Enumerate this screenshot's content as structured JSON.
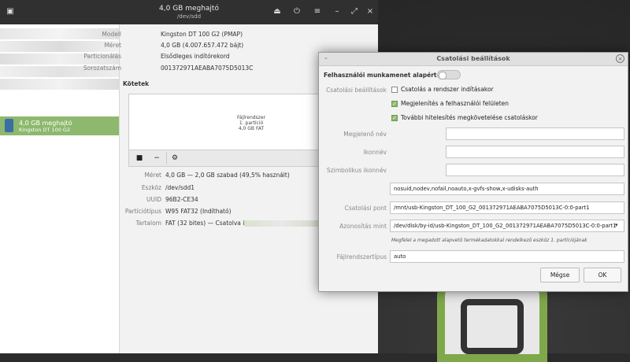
{
  "window": {
    "title": "4,0 GB meghajtó",
    "subtitle": "/dev/sdd",
    "icons": [
      "drives-icon",
      "eject-icon",
      "power-icon",
      "menu-icon",
      "minimize-icon",
      "maximize-icon",
      "close-icon"
    ]
  },
  "sidebar": {
    "selected_drive": {
      "name": "4,0 GB meghajtó",
      "model": "Kingston DT 100 G2"
    }
  },
  "drive_info": [
    {
      "label": "Modell",
      "value": "Kingston DT 100 G2 (PMAP)"
    },
    {
      "label": "Méret",
      "value": "4,0 GB (4.007.657.472 bájt)"
    },
    {
      "label": "Particionálás",
      "value": "Elsődleges indítórekord"
    },
    {
      "label": "Sorozatszám",
      "value": "001372971AEABA7075D5013C"
    }
  ],
  "volumes": {
    "heading": "Kötetek",
    "map_lines": [
      "Fájlrendszer",
      "1. partíció",
      "4,0 GB FAT"
    ]
  },
  "volume_info": [
    {
      "label": "Méret",
      "value": "4,0 GB — 2,0 GB szabad (49,5% használt)"
    },
    {
      "label": "Eszköz",
      "value": "/dev/sdd1"
    },
    {
      "label": "UUID",
      "value": "96B2-CE34"
    },
    {
      "label": "Partíciótípus",
      "value": "W95 FAT32 (Indítható)"
    },
    {
      "label": "Tartalom",
      "value": "FAT (32 bites) — Csatolva ide:"
    }
  ],
  "dialog": {
    "title": "Csatolási beállítások",
    "session_defaults_label": "Felhasználói munkamenet alapértékei",
    "mount_options_label": "Csatolási beállítások",
    "checkboxes": [
      {
        "label": "Csatolás a rendszer indításakor",
        "checked": false
      },
      {
        "label": "Megjelenítés a felhasználói felületen",
        "checked": true
      },
      {
        "label": "További hitelesítés megkövetelése csatoláskor",
        "checked": true
      }
    ],
    "display_name_label": "Megjelenő név",
    "display_name_value": "",
    "icon_name_label": "Ikonnév",
    "icon_name_value": "",
    "symbolic_icon_label": "Szimbolikus ikonnév",
    "symbolic_icon_value": "",
    "options_value": "nosuid,nodev,nofail,noauto,x-gvfs-show,x-udisks-auth",
    "mount_point_label": "Csatolási pont",
    "mount_point_value": "/mnt/usb-Kingston_DT_100_G2_001372971AEABA7075D5013C-0:0-part1",
    "identify_label": "Azonosítás mint",
    "identify_value": "/dev/disk/by-id/usb-Kingston_DT_100_G2_001372971AEABA7075D5013C-0:0-part1",
    "identify_hint": "Megfelel a megadott alapvető termékadatokkal rendelkező eszköz 1. partíciójának",
    "fs_type_label": "Fájlrendszertípus",
    "fs_type_value": "auto",
    "cancel_label": "Mégse",
    "ok_label": "OK"
  },
  "colors": {
    "accent": "#8db86d",
    "header": "#303030"
  }
}
